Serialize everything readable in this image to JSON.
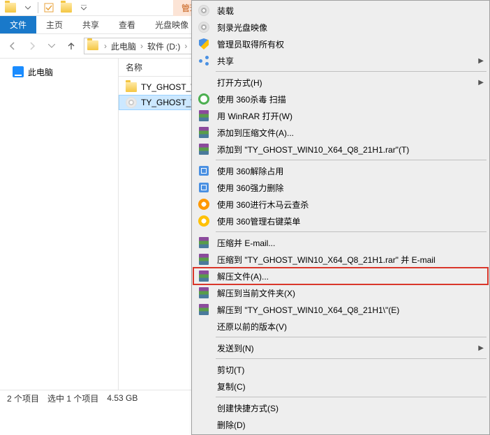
{
  "titlebar": {
    "context_tab": "管理"
  },
  "ribbon": {
    "file": "文件",
    "home": "主页",
    "share": "共享",
    "view": "查看",
    "disc": "光盘映像"
  },
  "breadcrumb": {
    "this_pc": "此电脑",
    "drive": "软件 (D:)"
  },
  "tree": {
    "this_pc": "此电脑"
  },
  "columns": {
    "name": "名称"
  },
  "files": [
    {
      "name": "TY_GHOST_W",
      "type": "folder"
    },
    {
      "name": "TY_GHOST_W",
      "type": "disc",
      "selected": true
    }
  ],
  "status": {
    "items": "2 个项目",
    "selected": "选中 1 个项目",
    "size": "4.53 GB"
  },
  "menu": {
    "items": [
      {
        "icon": "disc",
        "label": "装载"
      },
      {
        "icon": "disc",
        "label": "刻录光盘映像"
      },
      {
        "icon": "shield",
        "label": "管理员取得所有权"
      },
      {
        "icon": "share",
        "label": "共享",
        "arrow": true,
        "sep_after": true
      },
      {
        "icon": "none",
        "label": "打开方式(H)",
        "arrow": true
      },
      {
        "icon": "360",
        "label": "使用 360杀毒 扫描"
      },
      {
        "icon": "rar",
        "label": "用 WinRAR 打开(W)"
      },
      {
        "icon": "rar",
        "label": "添加到压缩文件(A)..."
      },
      {
        "icon": "rar",
        "label": "添加到 \"TY_GHOST_WIN10_X64_Q8_21H1.rar\"(T)",
        "sep_after": true
      },
      {
        "icon": "box",
        "label": "使用 360解除占用"
      },
      {
        "icon": "box",
        "label": "使用 360强力删除"
      },
      {
        "icon": "360orange",
        "label": "使用 360进行木马云查杀"
      },
      {
        "icon": "360cloud",
        "label": "使用 360管理右键菜单",
        "sep_after": true
      },
      {
        "icon": "rar",
        "label": "压缩并 E-mail..."
      },
      {
        "icon": "rar",
        "label": "压缩到 \"TY_GHOST_WIN10_X64_Q8_21H1.rar\" 并 E-mail"
      },
      {
        "icon": "rar",
        "label": "解压文件(A)...",
        "highlight": true
      },
      {
        "icon": "rar",
        "label": "解压到当前文件夹(X)"
      },
      {
        "icon": "rar",
        "label": "解压到 \"TY_GHOST_WIN10_X64_Q8_21H1\\\"(E)"
      },
      {
        "icon": "none",
        "label": "还原以前的版本(V)",
        "sep_after": true
      },
      {
        "icon": "none",
        "label": "发送到(N)",
        "arrow": true,
        "sep_after": true
      },
      {
        "icon": "none",
        "label": "剪切(T)"
      },
      {
        "icon": "none",
        "label": "复制(C)",
        "sep_after": true
      },
      {
        "icon": "none",
        "label": "创建快捷方式(S)"
      },
      {
        "icon": "none",
        "label": "删除(D)"
      }
    ]
  }
}
